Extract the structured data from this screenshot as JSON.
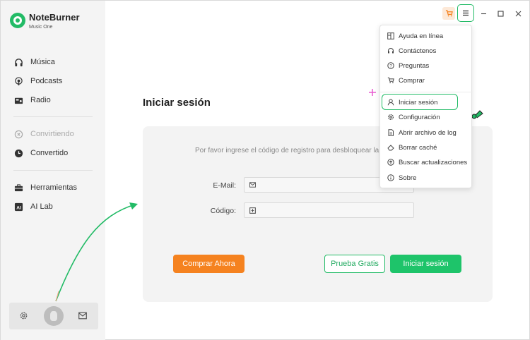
{
  "app": {
    "name": "NoteBurner",
    "subtitle": "Music One"
  },
  "sidebar": {
    "items": [
      {
        "label": "Música",
        "icon": "headphones-icon"
      },
      {
        "label": "Podcasts",
        "icon": "podcast-icon"
      },
      {
        "label": "Radio",
        "icon": "radio-icon"
      },
      {
        "label": "Convirtiendo",
        "icon": "converting-icon",
        "disabled": true
      },
      {
        "label": "Convertido",
        "icon": "clock-icon"
      },
      {
        "label": "Herramientas",
        "icon": "toolbox-icon"
      },
      {
        "label": "AI Lab",
        "icon": "ai-icon"
      }
    ]
  },
  "login": {
    "title": "Iniciar sesión",
    "message": "Por favor ingrese el código de registro para desbloquear la",
    "email_label": "E-Mail:",
    "email_value": "",
    "code_label": "Código:",
    "code_value": "",
    "buy_label": "Comprar Ahora",
    "free_label": "Prueba Gratis",
    "login_label": "Iniciar sesión"
  },
  "menu": {
    "items": [
      {
        "label": "Ayuda en línea",
        "icon": "help-book-icon"
      },
      {
        "label": "Contáctenos",
        "icon": "headset-icon"
      },
      {
        "label": "Preguntas",
        "icon": "question-icon"
      },
      {
        "label": "Comprar",
        "icon": "cart-icon"
      },
      {
        "label": "Iniciar sesión",
        "icon": "user-icon",
        "highlighted": true
      },
      {
        "label": "Configuración",
        "icon": "gear-icon"
      },
      {
        "label": "Abrir archivo de log",
        "icon": "file-icon"
      },
      {
        "label": "Borrar caché",
        "icon": "eraser-icon"
      },
      {
        "label": "Buscar actualizaciones",
        "icon": "update-icon"
      },
      {
        "label": "Sobre",
        "icon": "info-icon"
      }
    ]
  },
  "colors": {
    "accent": "#22bb66",
    "buy": "#f5821f",
    "sidebar": "#f4f4f4",
    "panel": "#f3f3f3"
  }
}
